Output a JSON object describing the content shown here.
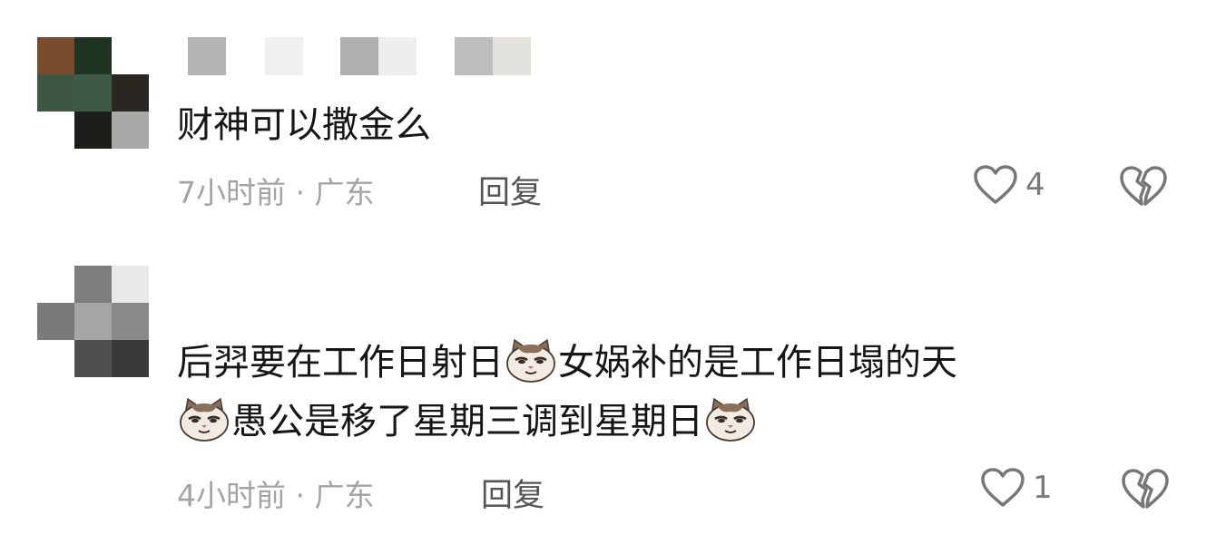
{
  "comments": [
    {
      "text": "财神可以撒金么",
      "time_location": "7小时前 · 广东",
      "reply_label": "回复",
      "like_count": "4",
      "avatar_colors": [
        "#7a4a2e",
        "#1f3323",
        "#ffffff",
        "#3e5745",
        "#3f5a44",
        "#2a2723",
        "#ffffff",
        "#1e1d1a",
        "#a8a8a8"
      ]
    },
    {
      "text_line1_a": "后羿要在工作日射日",
      "text_line1_b": "女娲补的是工作日塌的天",
      "text_line2_a": "愚公是移了星期三调到星期日",
      "time_location": "4小时前 · 广东",
      "reply_label": "回复",
      "like_count": "1",
      "emoji_name": "smug-cat-emoji",
      "avatar_colors": [
        "#ffffff",
        "#7e7e7e",
        "#e8e8e8",
        "#7a7a7a",
        "#a6a6a6",
        "#898989",
        "#ffffff",
        "#4f4f4f",
        "#3a3a3a"
      ]
    }
  ],
  "icons": {
    "like": "heart-outline-icon",
    "dislike": "broken-heart-icon"
  },
  "colors": {
    "text": "#161616",
    "meta": "#a4a4a4",
    "reply": "#555555",
    "icon": "#777777"
  }
}
